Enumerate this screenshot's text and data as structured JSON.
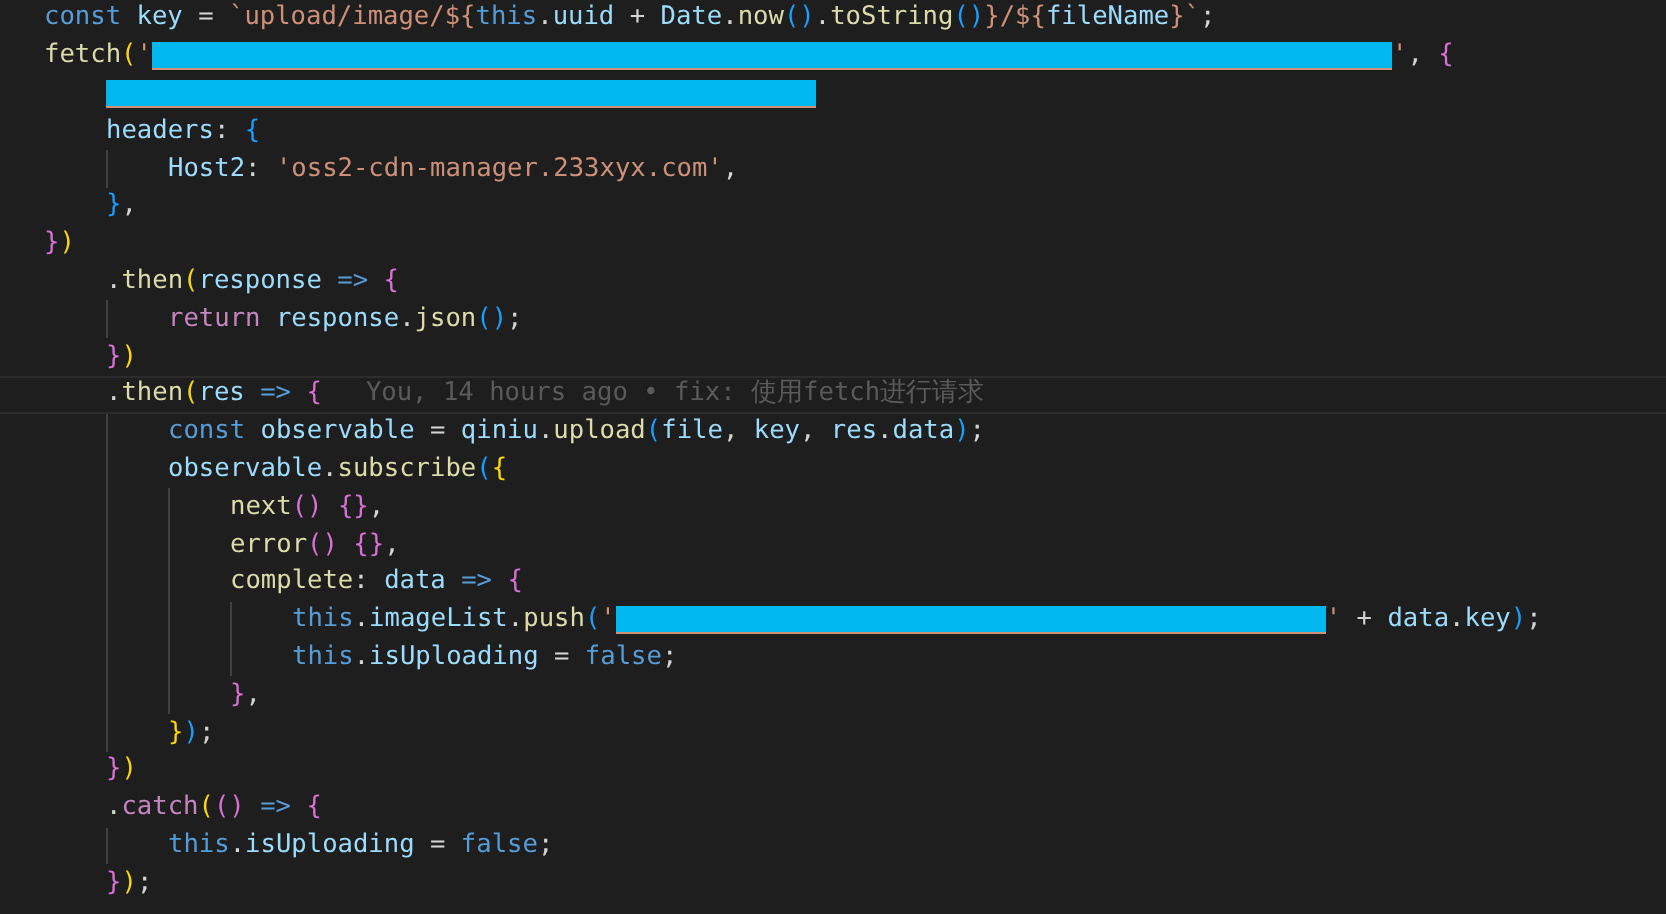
{
  "editor": {
    "lines": [
      {
        "current": false,
        "tokens": [
          {
            "kind": "kw",
            "text": "const "
          },
          {
            "kind": "var",
            "text": "key"
          },
          {
            "kind": "p",
            "text": " = "
          },
          {
            "kind": "str",
            "text": "`upload/image/${"
          },
          {
            "kind": "kw",
            "text": "this"
          },
          {
            "kind": "p",
            "text": "."
          },
          {
            "kind": "var",
            "text": "uuid"
          },
          {
            "kind": "p",
            "text": " + "
          },
          {
            "kind": "var",
            "text": "Date"
          },
          {
            "kind": "p",
            "text": "."
          },
          {
            "kind": "fn",
            "text": "now"
          },
          {
            "kind": "b3",
            "text": "()"
          },
          {
            "kind": "p",
            "text": "."
          },
          {
            "kind": "fn",
            "text": "toString"
          },
          {
            "kind": "b3",
            "text": "()"
          },
          {
            "kind": "str",
            "text": "}/${"
          },
          {
            "kind": "var",
            "text": "fileName"
          },
          {
            "kind": "str",
            "text": "}`"
          },
          {
            "kind": "p",
            "text": ";"
          }
        ]
      },
      {
        "current": false,
        "tokens": [
          {
            "kind": "fn",
            "text": "fetch"
          },
          {
            "kind": "b1",
            "text": "("
          },
          {
            "kind": "str",
            "text": "'"
          },
          {
            "kind": "redact"
          },
          {
            "kind": "str",
            "text": "'"
          },
          {
            "kind": "p",
            "text": ", "
          },
          {
            "kind": "b2",
            "text": "{"
          }
        ],
        "children": [
          {
            "current": false,
            "tokens": [
              {
                "kind": "redact"
              }
            ]
          },
          {
            "current": false,
            "tokens": [
              {
                "kind": "var",
                "text": "headers"
              },
              {
                "kind": "p",
                "text": ": "
              },
              {
                "kind": "b3",
                "text": "{"
              }
            ],
            "children": [
              {
                "current": false,
                "tokens": [
                  {
                    "kind": "var",
                    "text": "Host2"
                  },
                  {
                    "kind": "p",
                    "text": ": "
                  },
                  {
                    "kind": "str",
                    "text": "'oss2-cdn-manager.233xyx.com'"
                  },
                  {
                    "kind": "p",
                    "text": ","
                  }
                ]
              }
            ]
          },
          {
            "current": false,
            "tokens": [
              {
                "kind": "b3",
                "text": "}"
              },
              {
                "kind": "p",
                "text": ","
              }
            ]
          }
        ]
      },
      {
        "current": false,
        "tokens": [
          {
            "kind": "b2",
            "text": "}"
          },
          {
            "kind": "b1",
            "text": ")"
          }
        ],
        "children": [
          {
            "current": false,
            "tokens": [
              {
                "kind": "p",
                "text": "."
              },
              {
                "kind": "fn",
                "text": "then"
              },
              {
                "kind": "b1",
                "text": "("
              },
              {
                "kind": "var",
                "text": "response"
              },
              {
                "kind": "kw",
                "text": " => "
              },
              {
                "kind": "b2",
                "text": "{"
              }
            ],
            "children": [
              {
                "current": false,
                "tokens": [
                  {
                    "kind": "ctl",
                    "text": "return "
                  },
                  {
                    "kind": "var",
                    "text": "response"
                  },
                  {
                    "kind": "p",
                    "text": "."
                  },
                  {
                    "kind": "fn",
                    "text": "json"
                  },
                  {
                    "kind": "b3",
                    "text": "()"
                  },
                  {
                    "kind": "p",
                    "text": ";"
                  }
                ]
              }
            ]
          },
          {
            "current": false,
            "tokens": [
              {
                "kind": "b2",
                "text": "}"
              },
              {
                "kind": "b1",
                "text": ")"
              }
            ]
          },
          {
            "current": true,
            "tokens": [
              {
                "kind": "p",
                "text": "."
              },
              {
                "kind": "fn",
                "text": "then"
              },
              {
                "kind": "b1",
                "text": "("
              },
              {
                "kind": "var",
                "text": "res"
              },
              {
                "kind": "kw",
                "text": " => "
              },
              {
                "kind": "b2",
                "text": "{"
              },
              {
                "kind": "blame",
                "text": "You, 14 hours ago • fix: 使用fetch进行请求"
              }
            ],
            "children": [
              {
                "current": false,
                "tokens": [
                  {
                    "kind": "kw",
                    "text": "const "
                  },
                  {
                    "kind": "var",
                    "text": "observable"
                  },
                  {
                    "kind": "p",
                    "text": " = "
                  },
                  {
                    "kind": "var",
                    "text": "qiniu"
                  },
                  {
                    "kind": "p",
                    "text": "."
                  },
                  {
                    "kind": "fn",
                    "text": "upload"
                  },
                  {
                    "kind": "b3",
                    "text": "("
                  },
                  {
                    "kind": "var",
                    "text": "file"
                  },
                  {
                    "kind": "p",
                    "text": ", "
                  },
                  {
                    "kind": "var",
                    "text": "key"
                  },
                  {
                    "kind": "p",
                    "text": ", "
                  },
                  {
                    "kind": "var",
                    "text": "res"
                  },
                  {
                    "kind": "p",
                    "text": "."
                  },
                  {
                    "kind": "var",
                    "text": "data"
                  },
                  {
                    "kind": "b3",
                    "text": ")"
                  },
                  {
                    "kind": "p",
                    "text": ";"
                  }
                ]
              },
              {
                "current": false,
                "tokens": [
                  {
                    "kind": "var",
                    "text": "observable"
                  },
                  {
                    "kind": "p",
                    "text": "."
                  },
                  {
                    "kind": "fn",
                    "text": "subscribe"
                  },
                  {
                    "kind": "b3",
                    "text": "("
                  },
                  {
                    "kind": "b1",
                    "text": "{"
                  }
                ],
                "children": [
                  {
                    "current": false,
                    "tokens": [
                      {
                        "kind": "fn",
                        "text": "next"
                      },
                      {
                        "kind": "b2",
                        "text": "()"
                      },
                      {
                        "kind": "b2",
                        "text": " {}"
                      },
                      {
                        "kind": "p",
                        "text": ","
                      }
                    ]
                  },
                  {
                    "current": false,
                    "tokens": [
                      {
                        "kind": "fn",
                        "text": "error"
                      },
                      {
                        "kind": "b2",
                        "text": "()"
                      },
                      {
                        "kind": "b2",
                        "text": " {}"
                      },
                      {
                        "kind": "p",
                        "text": ","
                      }
                    ]
                  },
                  {
                    "current": false,
                    "tokens": [
                      {
                        "kind": "fn",
                        "text": "complete"
                      },
                      {
                        "kind": "p",
                        "text": ": "
                      },
                      {
                        "kind": "var",
                        "text": "data"
                      },
                      {
                        "kind": "kw",
                        "text": " => "
                      },
                      {
                        "kind": "b2",
                        "text": "{"
                      }
                    ],
                    "children": [
                      {
                        "current": false,
                        "tokens": [
                          {
                            "kind": "kw",
                            "text": "this"
                          },
                          {
                            "kind": "p",
                            "text": "."
                          },
                          {
                            "kind": "var",
                            "text": "imageList"
                          },
                          {
                            "kind": "p",
                            "text": "."
                          },
                          {
                            "kind": "fn",
                            "text": "push"
                          },
                          {
                            "kind": "b3",
                            "text": "("
                          },
                          {
                            "kind": "str",
                            "text": "'"
                          },
                          {
                            "kind": "redact"
                          },
                          {
                            "kind": "str",
                            "text": "'"
                          },
                          {
                            "kind": "p",
                            "text": " + "
                          },
                          {
                            "kind": "var",
                            "text": "data"
                          },
                          {
                            "kind": "p",
                            "text": "."
                          },
                          {
                            "kind": "var",
                            "text": "key"
                          },
                          {
                            "kind": "b3",
                            "text": ")"
                          },
                          {
                            "kind": "p",
                            "text": ";"
                          }
                        ]
                      },
                      {
                        "current": false,
                        "tokens": [
                          {
                            "kind": "kw",
                            "text": "this"
                          },
                          {
                            "kind": "p",
                            "text": "."
                          },
                          {
                            "kind": "var",
                            "text": "isUploading"
                          },
                          {
                            "kind": "p",
                            "text": " = "
                          },
                          {
                            "kind": "kw",
                            "text": "false"
                          },
                          {
                            "kind": "p",
                            "text": ";"
                          }
                        ]
                      }
                    ]
                  },
                  {
                    "current": false,
                    "tokens": [
                      {
                        "kind": "b2",
                        "text": "}"
                      },
                      {
                        "kind": "p",
                        "text": ","
                      }
                    ]
                  }
                ]
              },
              {
                "current": false,
                "tokens": [
                  {
                    "kind": "b1",
                    "text": "}"
                  },
                  {
                    "kind": "b3",
                    "text": ")"
                  },
                  {
                    "kind": "p",
                    "text": ";"
                  }
                ]
              }
            ]
          },
          {
            "current": false,
            "tokens": [
              {
                "kind": "b2",
                "text": "}"
              },
              {
                "kind": "b1",
                "text": ")"
              }
            ]
          },
          {
            "current": false,
            "tokens": [
              {
                "kind": "p",
                "text": "."
              },
              {
                "kind": "ctl",
                "text": "catch"
              },
              {
                "kind": "b1",
                "text": "("
              },
              {
                "kind": "b2",
                "text": "()"
              },
              {
                "kind": "kw",
                "text": " => "
              },
              {
                "kind": "b2",
                "text": "{"
              }
            ],
            "children": [
              {
                "current": false,
                "tokens": [
                  {
                    "kind": "kw",
                    "text": "this"
                  },
                  {
                    "kind": "p",
                    "text": "."
                  },
                  {
                    "kind": "var",
                    "text": "isUploading"
                  },
                  {
                    "kind": "p",
                    "text": " = "
                  },
                  {
                    "kind": "kw",
                    "text": "false"
                  },
                  {
                    "kind": "p",
                    "text": ";"
                  }
                ]
              }
            ]
          },
          {
            "current": false,
            "tokens": [
              {
                "kind": "b2",
                "text": "}"
              },
              {
                "kind": "b1",
                "text": ")"
              },
              {
                "kind": "p",
                "text": ";"
              }
            ]
          }
        ]
      }
    ]
  }
}
